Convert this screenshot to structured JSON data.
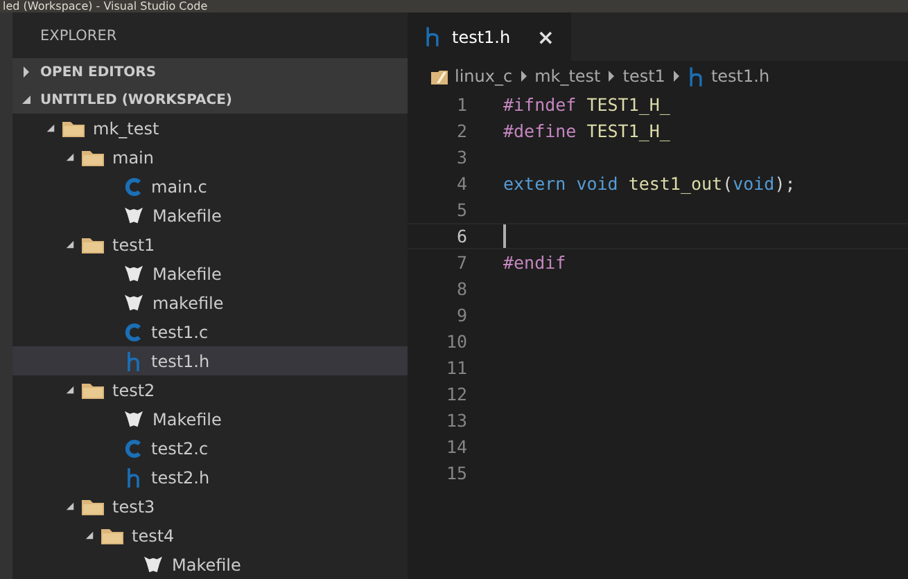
{
  "window": {
    "title": "led (Workspace) - Visual Studio Code"
  },
  "sidebar": {
    "title": "EXPLORER",
    "sections": [
      {
        "label": "OPEN EDITORS",
        "expanded": false
      },
      {
        "label": "UNTITLED (WORKSPACE)",
        "expanded": true
      }
    ],
    "tree": [
      {
        "label": "mk_test",
        "kind": "folder",
        "expanded": true,
        "selected": false,
        "children": [
          {
            "label": "main",
            "kind": "folder",
            "expanded": true,
            "selected": false,
            "children": [
              {
                "label": "main.c",
                "kind": "c",
                "selected": false
              },
              {
                "label": "Makefile",
                "kind": "make",
                "selected": false
              }
            ]
          },
          {
            "label": "test1",
            "kind": "folder",
            "expanded": true,
            "selected": false,
            "children": [
              {
                "label": "Makefile",
                "kind": "make",
                "selected": false
              },
              {
                "label": "makefile",
                "kind": "make",
                "selected": false
              },
              {
                "label": "test1.c",
                "kind": "c",
                "selected": false
              },
              {
                "label": "test1.h",
                "kind": "h",
                "selected": true
              }
            ]
          },
          {
            "label": "test2",
            "kind": "folder",
            "expanded": true,
            "selected": false,
            "children": [
              {
                "label": "Makefile",
                "kind": "make",
                "selected": false
              },
              {
                "label": "test2.c",
                "kind": "c",
                "selected": false
              },
              {
                "label": "test2.h",
                "kind": "h",
                "selected": false
              }
            ]
          },
          {
            "label": "test3",
            "kind": "folder",
            "expanded": true,
            "selected": false,
            "children": [
              {
                "label": "test4",
                "kind": "folder",
                "expanded": true,
                "selected": false,
                "children": [
                  {
                    "label": "Makefile",
                    "kind": "make",
                    "selected": false
                  }
                ]
              }
            ]
          }
        ]
      }
    ]
  },
  "tabs": [
    {
      "label": "test1.h",
      "kind": "h",
      "selected": true,
      "close": "×"
    }
  ],
  "breadcrumb": [
    {
      "label": "linux_c",
      "kind": "folder"
    },
    {
      "label": "mk_test",
      "kind": "none"
    },
    {
      "label": "test1",
      "kind": "none"
    },
    {
      "label": "test1.h",
      "kind": "h"
    }
  ],
  "editor": {
    "lines": [
      {
        "number": "1",
        "current": false,
        "tokens": [
          {
            "text": "#ifndef ",
            "kind": "directive"
          },
          {
            "text": "TEST1_H_",
            "kind": "macro"
          }
        ]
      },
      {
        "number": "2",
        "current": false,
        "tokens": [
          {
            "text": "#define ",
            "kind": "directive"
          },
          {
            "text": "TEST1_H_",
            "kind": "macro"
          }
        ]
      },
      {
        "number": "3",
        "current": false
      },
      {
        "number": "4",
        "current": false,
        "tokens": [
          {
            "text": "extern ",
            "kind": "keyword"
          },
          {
            "text": "void ",
            "kind": "keyword"
          },
          {
            "text": "test1_out",
            "kind": "function"
          },
          {
            "text": "(",
            "kind": "plain"
          },
          {
            "text": "void",
            "kind": "keyword"
          },
          {
            "text": ");",
            "kind": "plain"
          }
        ]
      },
      {
        "number": "5",
        "current": false
      },
      {
        "number": "6",
        "current": true
      },
      {
        "number": "7",
        "current": false,
        "tokens": [
          {
            "text": "#endif",
            "kind": "directive"
          }
        ]
      },
      {
        "number": "8",
        "current": false
      },
      {
        "number": "9",
        "current": false
      },
      {
        "number": "10",
        "current": false
      },
      {
        "number": "11",
        "current": false
      },
      {
        "number": "12",
        "current": false
      },
      {
        "number": "13",
        "current": false
      },
      {
        "number": "14",
        "current": false
      },
      {
        "number": "15",
        "current": false
      }
    ]
  }
}
